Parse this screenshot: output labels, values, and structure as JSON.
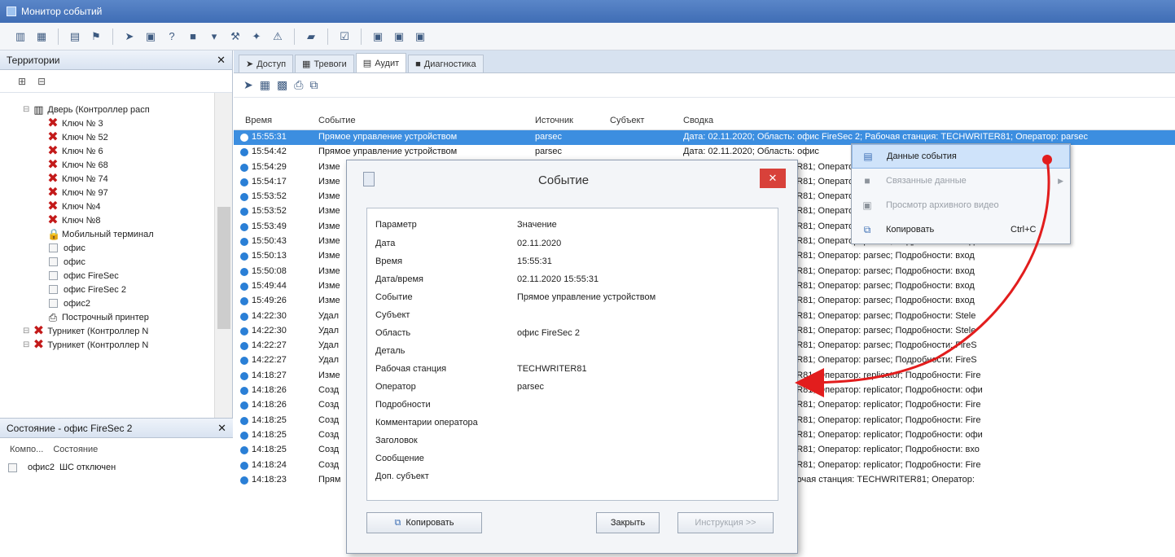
{
  "window": {
    "title": "Монитор событий"
  },
  "toolbar": {
    "icons": [
      "view-icon",
      "grid-icon",
      "layout-icon",
      "flag-icon",
      "filter-icon",
      "panel-icon",
      "help-icon",
      "black-square-icon",
      "dropdown-icon",
      "tool-icon",
      "tool2-icon",
      "alert-icon",
      "folder-icon",
      "checklist-icon",
      "stop-icon",
      "stop2-icon",
      "stop3-icon"
    ]
  },
  "territory": {
    "title": "Территории",
    "items": [
      {
        "label": "Дверь (Контроллер расп",
        "icon": "door",
        "indent": 1
      },
      {
        "label": "Ключ № 3",
        "icon": "x",
        "indent": 2
      },
      {
        "label": "Ключ № 52",
        "icon": "x",
        "indent": 2
      },
      {
        "label": "Ключ № 6",
        "icon": "x",
        "indent": 2
      },
      {
        "label": "Ключ № 68",
        "icon": "x",
        "indent": 2
      },
      {
        "label": "Ключ № 74",
        "icon": "x",
        "indent": 2
      },
      {
        "label": "Ключ № 97",
        "icon": "x",
        "indent": 2
      },
      {
        "label": "Ключ №4",
        "icon": "x",
        "indent": 2
      },
      {
        "label": "Ключ №8",
        "icon": "x",
        "indent": 2
      },
      {
        "label": "Мобильный терминал",
        "icon": "lock",
        "indent": 2
      },
      {
        "label": "офис",
        "icon": "box",
        "indent": 2
      },
      {
        "label": "офис",
        "icon": "box",
        "indent": 2
      },
      {
        "label": "офис FireSec",
        "icon": "box",
        "indent": 2
      },
      {
        "label": "офис FireSec 2",
        "icon": "box",
        "indent": 2
      },
      {
        "label": "офис2",
        "icon": "box",
        "indent": 2
      },
      {
        "label": "Построчный принтер",
        "icon": "printer",
        "indent": 2
      },
      {
        "label": "Турникет (Контроллер N",
        "icon": "x",
        "indent": 1
      },
      {
        "label": "Турникет (Контроллер N",
        "icon": "x",
        "indent": 1
      }
    ]
  },
  "state": {
    "title": "Состояние - офис FireSec 2",
    "col1": "Компо...",
    "col2": "Состояние",
    "rows": [
      {
        "name": "офис2",
        "state": "ШС отключен"
      }
    ]
  },
  "tabs": [
    {
      "label": "Доступ",
      "icon": "➤"
    },
    {
      "label": "Тревоги",
      "icon": "▦"
    },
    {
      "label": "Аудит",
      "icon": "▤",
      "active": true
    },
    {
      "label": "Диагностика",
      "icon": "■"
    }
  ],
  "grid": {
    "headers": {
      "time": "Время",
      "event": "Событие",
      "source": "Источник",
      "subject": "Субъект",
      "summary": "Сводка"
    },
    "rows": [
      {
        "time": "15:55:31",
        "event": "Прямое управление устройством",
        "source": "parsec",
        "summary": "Дата: 02.11.2020; Область: офис FireSec 2; Рабочая станция: TECHWRITER81; Оператор: parsec",
        "selected": true
      },
      {
        "time": "15:54:42",
        "event": "Прямое управление устройством",
        "source": "parsec",
        "summary": "Дата: 02.11.2020; Область: офис"
      },
      {
        "time": "15:54:29",
        "event": "Изме",
        "source": "",
        "summary": "очая станция: TECHWRITER81; Оператор: parsec; Подробности: офис"
      },
      {
        "time": "15:54:17",
        "event": "Изме",
        "source": "",
        "summary": "очая станция: TECHWRITER81; Оператор: parsec; Подробности: офис"
      },
      {
        "time": "15:53:52",
        "event": "Изме",
        "source": "",
        "summary": "очая станция: TECHWRITER81; Оператор: parsec; Подробности: вход"
      },
      {
        "time": "15:53:52",
        "event": "Изме",
        "source": "",
        "summary": "очая станция: TECHWRITER81; Оператор: parsec; Подробности: Дверь"
      },
      {
        "time": "15:53:49",
        "event": "Изме",
        "source": "",
        "summary": "очая станция: TECHWRITER81; Оператор: parsec; Подробности: вход"
      },
      {
        "time": "15:50:43",
        "event": "Изме",
        "source": "",
        "summary": "очая станция: TECHWRITER81; Оператор: parsec; Подробности: вход"
      },
      {
        "time": "15:50:13",
        "event": "Изме",
        "source": "",
        "summary": "очая станция: TECHWRITER81; Оператор: parsec; Подробности: вход"
      },
      {
        "time": "15:50:08",
        "event": "Изме",
        "source": "",
        "summary": "очая станция: TECHWRITER81; Оператор: parsec; Подробности: вход"
      },
      {
        "time": "15:49:44",
        "event": "Изме",
        "source": "",
        "summary": "очая станция: TECHWRITER81; Оператор: parsec; Подробности: вход"
      },
      {
        "time": "15:49:26",
        "event": "Изме",
        "source": "",
        "summary": "очая станция: TECHWRITER81; Оператор: parsec; Подробности: вход"
      },
      {
        "time": "14:22:30",
        "event": "Удал",
        "source": "",
        "summary": "очая станция: TECHWRITER81; Оператор: parsec; Подробности: Stele"
      },
      {
        "time": "14:22:30",
        "event": "Удал",
        "source": "",
        "summary": "очая станция: TECHWRITER81; Оператор: parsec; Подробности: Stele"
      },
      {
        "time": "14:22:27",
        "event": "Удал",
        "source": "",
        "summary": "очая станция: TECHWRITER81; Оператор: parsec; Подробности: FireS"
      },
      {
        "time": "14:22:27",
        "event": "Удал",
        "source": "",
        "summary": "очая станция: TECHWRITER81; Оператор: parsec; Подробности: FireS"
      },
      {
        "time": "14:18:27",
        "event": "Изме",
        "source": "",
        "summary": "очая станция: TECHWRITER81; Оператор: replicator; Подробности: Fire"
      },
      {
        "time": "14:18:26",
        "event": "Созд",
        "source": "",
        "summary": "очая станция: TECHWRITER81; Оператор: replicator; Подробности: офи"
      },
      {
        "time": "14:18:26",
        "event": "Созд",
        "source": "",
        "summary": "очая станция: TECHWRITER81; Оператор: replicator; Подробности: Fire"
      },
      {
        "time": "14:18:25",
        "event": "Созд",
        "source": "",
        "summary": "очая станция: TECHWRITER81; Оператор: replicator; Подробности: Fire"
      },
      {
        "time": "14:18:25",
        "event": "Созд",
        "source": "",
        "summary": "очая станция: TECHWRITER81; Оператор: replicator; Подробности: офи"
      },
      {
        "time": "14:18:25",
        "event": "Созд",
        "source": "",
        "summary": "очая станция: TECHWRITER81; Оператор: replicator; Подробности: вхо"
      },
      {
        "time": "14:18:24",
        "event": "Созд",
        "source": "",
        "summary": "очая станция: TECHWRITER81; Оператор: replicator; Подробности: Fire"
      },
      {
        "time": "14:18:23",
        "event": "Прям",
        "source": "",
        "summary": "асть: TECHWRITER81; Рабочая станция: TECHWRITER81; Оператор:"
      }
    ]
  },
  "context_menu": {
    "items": [
      {
        "label": "Данные события",
        "hover": true,
        "disabled": false,
        "shortcut": "",
        "submenu": false,
        "icon": "▤"
      },
      {
        "label": "Связанные данные",
        "hover": false,
        "disabled": true,
        "shortcut": "",
        "submenu": true,
        "icon": "■"
      },
      {
        "label": "Просмотр архивного видео",
        "hover": false,
        "disabled": true,
        "shortcut": "",
        "submenu": false,
        "icon": "▣"
      },
      {
        "label": "Копировать",
        "hover": false,
        "disabled": false,
        "shortcut": "Ctrl+C",
        "submenu": false,
        "icon": "⧉"
      }
    ]
  },
  "dialog": {
    "title": "Событие",
    "col_param": "Параметр",
    "col_value": "Значение",
    "rows": [
      {
        "param": "Дата",
        "value": "02.11.2020"
      },
      {
        "param": "Время",
        "value": "15:55:31"
      },
      {
        "param": "Дата/время",
        "value": "02.11.2020 15:55:31"
      },
      {
        "param": "Событие",
        "value": "Прямое управление устройством"
      },
      {
        "param": "Субъект",
        "value": ""
      },
      {
        "param": "Область",
        "value": "офис FireSec 2"
      },
      {
        "param": "Деталь",
        "value": ""
      },
      {
        "param": "Рабочая станция",
        "value": "TECHWRITER81"
      },
      {
        "param": "Оператор",
        "value": "parsec"
      },
      {
        "param": "Подробности",
        "value": ""
      },
      {
        "param": "Комментарии оператора",
        "value": ""
      },
      {
        "param": "Заголовок",
        "value": ""
      },
      {
        "param": "Сообщение",
        "value": ""
      },
      {
        "param": "Доп. субъект",
        "value": ""
      }
    ],
    "copy_button": "Копировать",
    "close_button": "Закрыть",
    "instructions_button": "Инструкция >>"
  },
  "colors": {
    "accent": "#3c8ee0",
    "arrow": "#e21d1d",
    "titlebar": "#4675be"
  }
}
